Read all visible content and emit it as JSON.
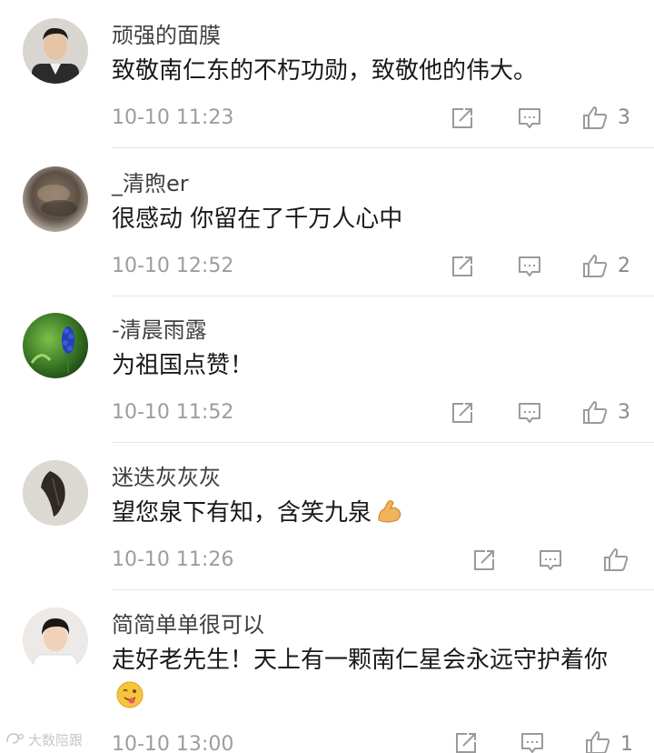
{
  "comments": [
    {
      "username": "顽强的面膜",
      "content": "致敬南仁东的不朽功勋，致敬他的伟大。",
      "timestamp": "10-10 11:23",
      "likes": "3",
      "avatar": "portrait-man-dark-suit"
    },
    {
      "username": "_清煦er",
      "content": "很感动 你留在了千万人心中",
      "timestamp": "10-10 12:52",
      "likes": "2",
      "avatar": "blurry-cat-photo"
    },
    {
      "username": "-清晨雨露",
      "content": "为祖国点赞！",
      "timestamp": "10-10 11:52",
      "likes": "3",
      "avatar": "blue-flower-green-background"
    },
    {
      "username": "迷迭灰灰灰",
      "content": "望您泉下有知，含笑九泉",
      "content_emoji": "flexed-biceps-emoji",
      "timestamp": "10-10 11:26",
      "likes": "",
      "avatar": "dark-leaf-on-wall"
    },
    {
      "username": "简简单单很可以",
      "content": "走好老先生！天上有一颗南仁星会永远守护着你",
      "content_emoji": "tongue-out-emoji",
      "timestamp": "10-10 13:00",
      "likes": "1",
      "avatar": "portrait-young-man-white-shirt"
    }
  ],
  "watermark": "大数陪跟",
  "colors": {
    "username": "#3f3f3f",
    "content": "#1a1a1a",
    "timestamp": "#9d9d9d",
    "icon": "#9a9a9a",
    "divider": "#e6e6e6"
  }
}
